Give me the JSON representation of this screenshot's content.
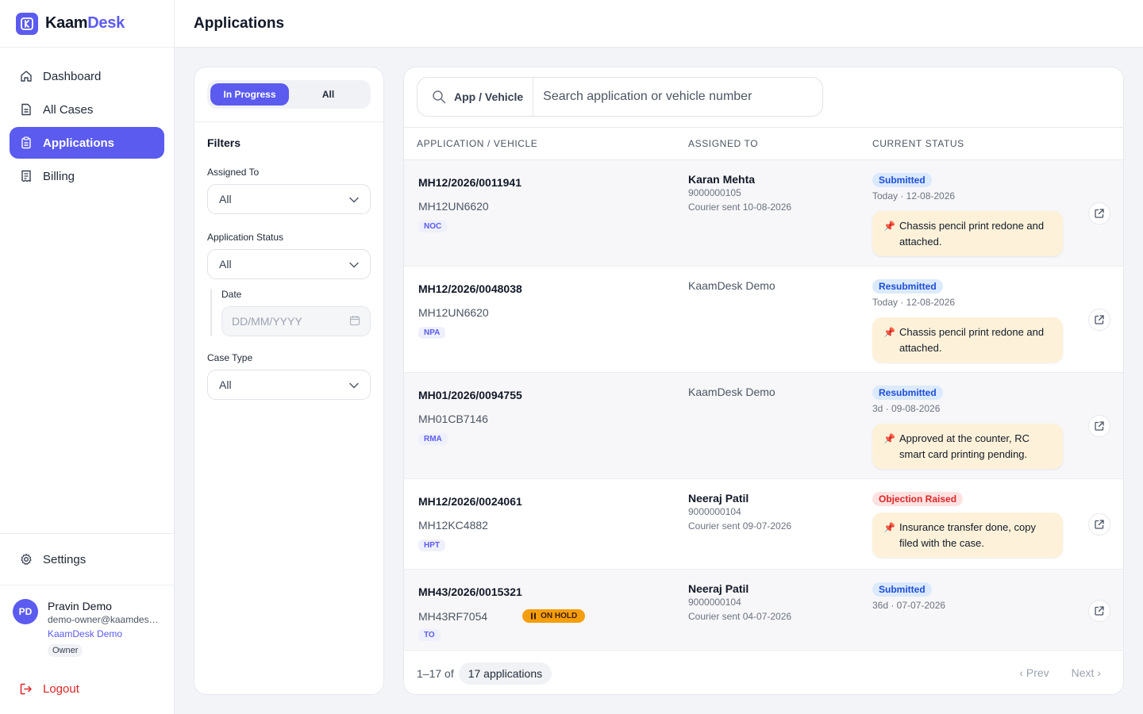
{
  "brand": {
    "part1": "Kaam",
    "part2": "Desk"
  },
  "colors": {
    "accent": "#5b5bf0",
    "danger": "#dc2626",
    "hold": "#f59e0b",
    "note_bg": "#fdf2d9"
  },
  "nav": {
    "items": [
      {
        "label": "Dashboard",
        "icon": "home-icon"
      },
      {
        "label": "All Cases",
        "icon": "file-icon"
      },
      {
        "label": "Applications",
        "icon": "clipboard-icon",
        "active": true
      },
      {
        "label": "Billing",
        "icon": "receipt-icon"
      }
    ],
    "settings": "Settings",
    "logout": "Logout"
  },
  "user": {
    "initials": "PD",
    "name": "Pravin Demo",
    "email": "demo-owner@kaamdesk.com",
    "org": "KaamDesk Demo",
    "role": "Owner"
  },
  "header": {
    "title": "Applications"
  },
  "filters": {
    "toggle": {
      "in_progress": "In Progress",
      "all": "All"
    },
    "title": "Filters",
    "assigned_to": {
      "label": "Assigned To",
      "value": "All"
    },
    "status": {
      "label": "Application Status",
      "value": "All"
    },
    "date": {
      "label": "Date",
      "placeholder": "DD/MM/YYYY"
    },
    "case_type": {
      "label": "Case Type",
      "value": "All"
    }
  },
  "search": {
    "scope": "App / Vehicle",
    "placeholder": "Search application or vehicle number"
  },
  "table": {
    "headers": {
      "app": "APPLICATION / VEHICLE",
      "assigned": "ASSIGNED TO",
      "status": "CURRENT STATUS"
    },
    "rows": [
      {
        "app_no": "MH12/2026/0011941",
        "vehicle": "MH12UN6620",
        "tag": "NOC",
        "on_hold": "",
        "assignee": "Karan Mehta",
        "phone": "9000000105",
        "courier": "Courier sent 10-08-2026",
        "status": "Submitted",
        "status_color": "blue",
        "status_date": "Today · 12-08-2026",
        "note": "Chassis pencil print redone and attached."
      },
      {
        "app_no": "MH12/2026/0048038",
        "vehicle": "MH12UN6620",
        "tag": "NPA",
        "on_hold": "",
        "assignee": "KaamDesk Demo",
        "phone": "",
        "courier": "",
        "status": "Resubmitted",
        "status_color": "blue",
        "status_date": "Today · 12-08-2026",
        "note": "Chassis pencil print redone and attached."
      },
      {
        "app_no": "MH01/2026/0094755",
        "vehicle": "MH01CB7146",
        "tag": "RMA",
        "on_hold": "",
        "assignee": "KaamDesk Demo",
        "phone": "",
        "courier": "",
        "status": "Resubmitted",
        "status_color": "blue",
        "status_date": "3d · 09-08-2026",
        "note": "Approved at the counter, RC smart card printing pending."
      },
      {
        "app_no": "MH12/2026/0024061",
        "vehicle": "MH12KC4882",
        "tag": "HPT",
        "on_hold": "",
        "assignee": "Neeraj Patil",
        "phone": "9000000104",
        "courier": "Courier sent 09-07-2026",
        "status": "Objection Raised",
        "status_color": "red",
        "status_date": "",
        "note": "Insurance transfer done, copy filed with the case."
      },
      {
        "app_no": "MH43/2026/0015321",
        "vehicle": "MH43RF7054",
        "tag": "TO",
        "on_hold": "ON HOLD",
        "assignee": "Neeraj Patil",
        "phone": "9000000104",
        "courier": "Courier sent 04-07-2026",
        "status": "Submitted",
        "status_color": "blue",
        "status_date": "36d · 07-07-2026",
        "note": ""
      }
    ]
  },
  "footer": {
    "range": "1–17 of",
    "count": "17 applications",
    "prev": "‹ Prev",
    "next": "Next ›"
  }
}
